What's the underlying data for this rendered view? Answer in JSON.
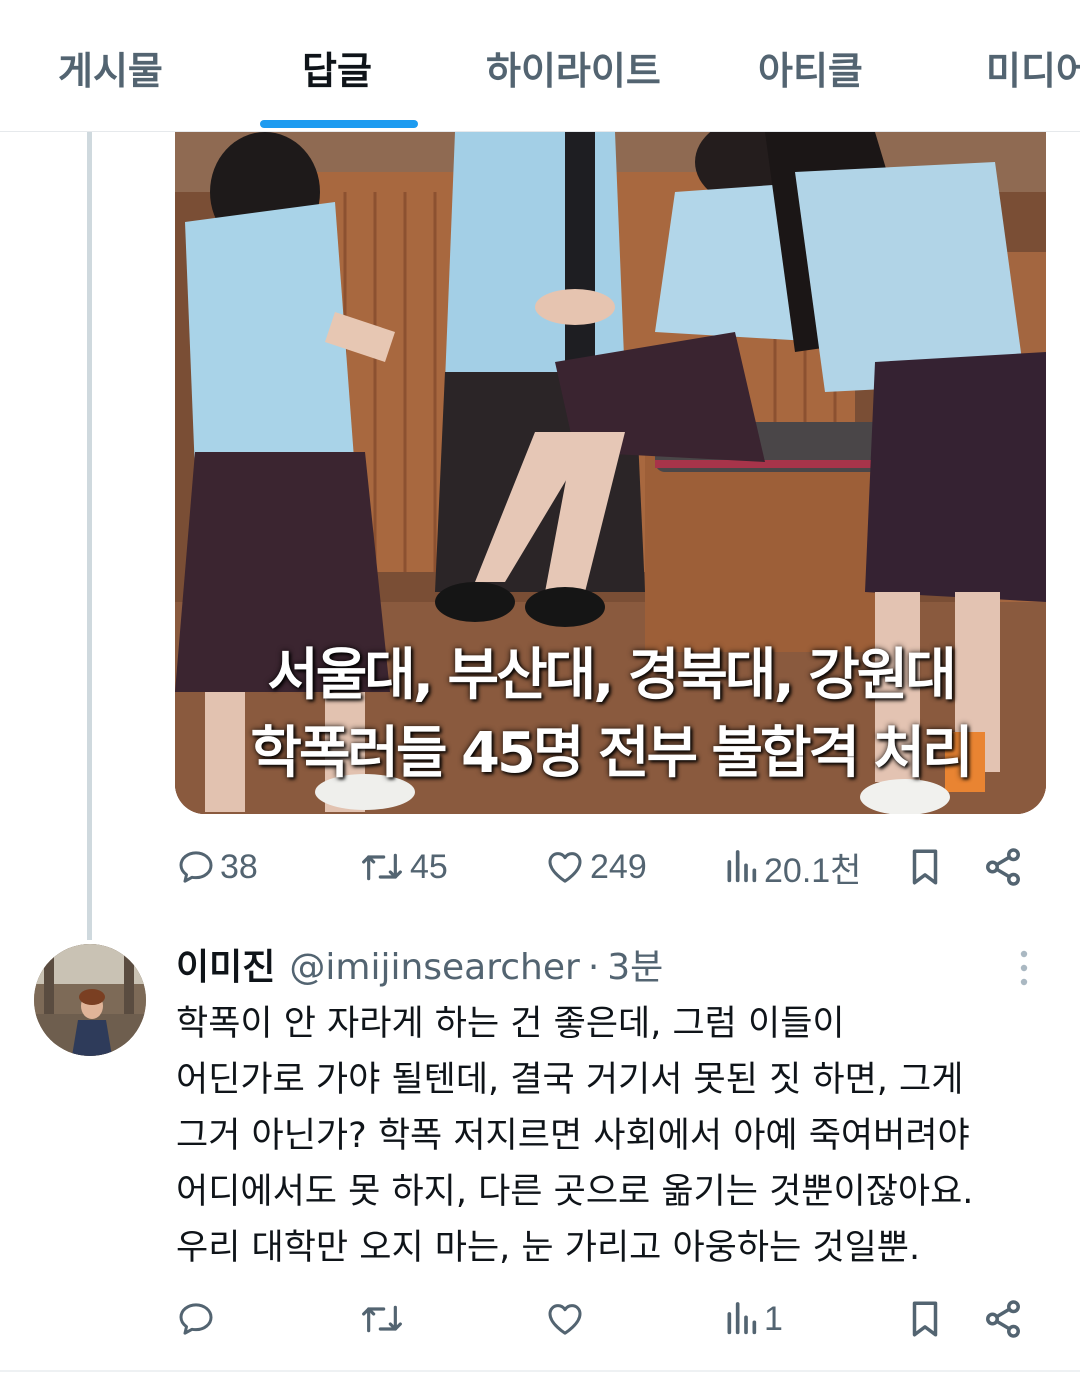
{
  "tabs": [
    {
      "label": "게시물",
      "active": false
    },
    {
      "label": "답글",
      "active": true
    },
    {
      "label": "하이라이트",
      "active": false
    },
    {
      "label": "아티클",
      "active": false
    },
    {
      "label": "미디어",
      "active": false
    }
  ],
  "accent_color": "#1d9bf0",
  "parent_tweet": {
    "media": {
      "caption_line1": "서울대, 부산대, 경북대, 강원대",
      "caption_line2": "학폭러들 45명 전부 불합격 처리"
    },
    "actions": {
      "replies": "38",
      "retweets": "45",
      "likes": "249",
      "views": "20.1천"
    }
  },
  "reply_tweet": {
    "display_name": "이미진",
    "handle": "@imijinsearcher",
    "separator": "·",
    "time": "3분",
    "body_lines": [
      "학폭이 안 자라게 하는 건 좋은데, 그럼 이들이",
      "어딘가로 가야 될텐데, 결국 거기서 못된 짓 하면, 그게",
      "그거 아닌가? 학폭 저지르면 사회에서 아예 죽여버려야",
      "어디에서도 못 하지, 다른 곳으로 옮기는 것뿐이잖아요.",
      "우리 대학만 오지 마는, 눈 가리고 아웅하는 것일뿐."
    ],
    "actions": {
      "views": "1"
    }
  }
}
